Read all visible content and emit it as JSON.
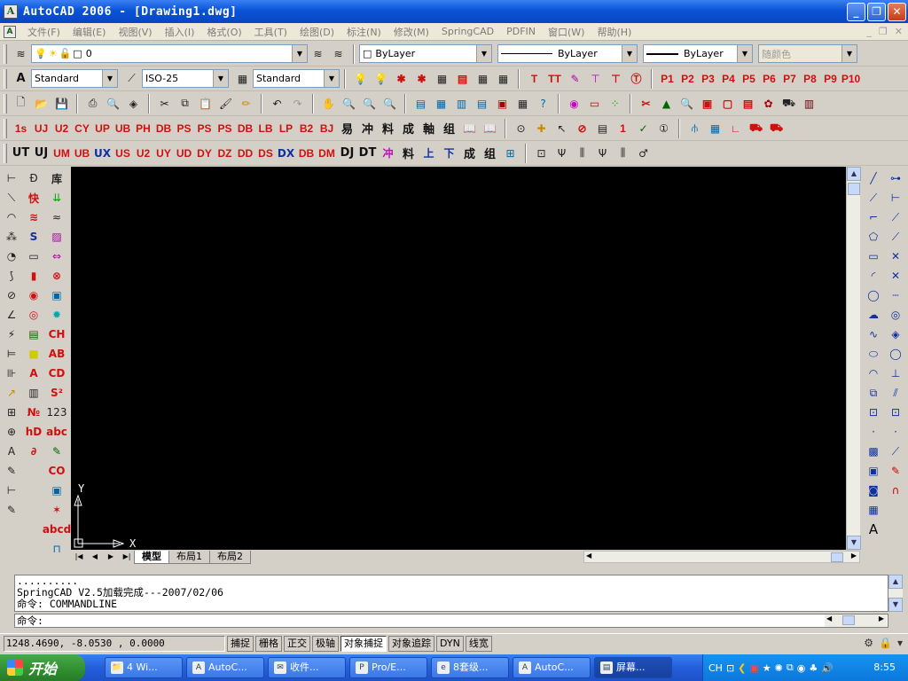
{
  "window": {
    "title": "AutoCAD 2006 - [Drawing1.dwg]",
    "app_icon_glyph": "A",
    "controls": [
      "_",
      "❐",
      "✕"
    ]
  },
  "menu": {
    "items": [
      "文件(F)",
      "编辑(E)",
      "视图(V)",
      "插入(I)",
      "格式(O)",
      "工具(T)",
      "绘图(D)",
      "标注(N)",
      "修改(M)",
      "SpringCAD",
      "PDFIN",
      "窗口(W)",
      "帮助(H)"
    ],
    "mdi_controls": [
      "_",
      "❐",
      "✕"
    ]
  },
  "layers": {
    "current_layer": "0",
    "color": "ByLayer",
    "linetype": "ByLayer",
    "lineweight": "ByLayer",
    "plot_style": "随颜色"
  },
  "styles": {
    "text_style": "Standard",
    "dim_style": "ISO-25",
    "table_style": "Standard",
    "p_buttons": [
      "P1",
      "P2",
      "P3",
      "P4",
      "P5",
      "P6",
      "P7",
      "P8",
      "P9",
      "P10"
    ],
    "tt_buttons": [
      "T",
      "TT"
    ]
  },
  "toolbar_spring1": [
    "1s",
    "UJ",
    "U2",
    "CY",
    "UP",
    "UB",
    "PH",
    "DB",
    "PS",
    "PS",
    "PS",
    "DB",
    "LB",
    "LP",
    "B2",
    "BJ",
    "易",
    "冲",
    "料",
    "成",
    "軸",
    "组"
  ],
  "toolbar_spring2": [
    "UT",
    "UJ",
    "UM",
    "UB",
    "UX",
    "US",
    "U2",
    "UY",
    "UD",
    "DY",
    "DZ",
    "DD",
    "DS",
    "DX",
    "DB",
    "DM",
    "DJ",
    "DT",
    "冲",
    "料",
    "上",
    "下",
    "成",
    "组"
  ],
  "layout_tabs": [
    "模型",
    "布局1",
    "布局2"
  ],
  "ucs": {
    "x_label": "X",
    "y_label": "Y"
  },
  "command": {
    "history": [
      "..........",
      "SpringCAD V2.5加载完成---2007/02/06",
      "命令: COMMANDLINE"
    ],
    "prompt": "命令:"
  },
  "status": {
    "coords": "1248.4690, -8.0530 , 0.0000",
    "toggles": [
      {
        "label": "捕捉",
        "on": false
      },
      {
        "label": "栅格",
        "on": false
      },
      {
        "label": "正交",
        "on": false
      },
      {
        "label": "极轴",
        "on": false
      },
      {
        "label": "对象捕捉",
        "on": true
      },
      {
        "label": "对象追踪",
        "on": false
      },
      {
        "label": "DYN",
        "on": false
      },
      {
        "label": "线宽",
        "on": false
      }
    ]
  },
  "taskbar": {
    "start_label": "开始",
    "tasks": [
      {
        "label": "4 Wi...",
        "icon": "📁",
        "active": false
      },
      {
        "label": "AutoC...",
        "icon": "A",
        "active": false
      },
      {
        "label": "收件...",
        "icon": "✉",
        "active": false
      },
      {
        "label": "Pro/E...",
        "icon": "P",
        "active": false
      },
      {
        "label": "8套级...",
        "icon": "e",
        "active": false
      },
      {
        "label": "AutoC...",
        "icon": "A",
        "active": false
      },
      {
        "label": "屏幕...",
        "icon": "▤",
        "active": true
      }
    ],
    "ime": "CH",
    "clock": "8:55"
  }
}
